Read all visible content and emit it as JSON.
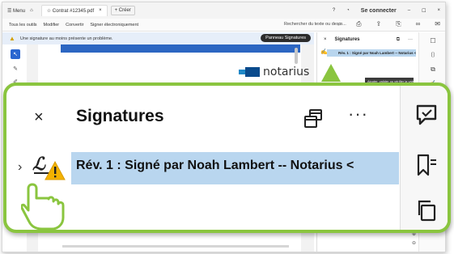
{
  "app": {
    "titlebar": {
      "menu_label": "☰ Menu",
      "home_icon": "home-icon",
      "tab_title": "☆ Contrat #12345.pdf",
      "tab_close": "×",
      "new_tab": "+ Créer",
      "signin": "Se connecter"
    },
    "menubar": {
      "items": [
        "Tous les outils",
        "Modifier",
        "Convertir",
        "Signer électroniquement"
      ],
      "search_text": "Rechercher du texte ou des o..."
    },
    "infobar": {
      "message": "Une signature au moins présente un problème.",
      "button": "Panneau Signatures"
    },
    "document": {
      "logo_text": "notarius"
    },
    "sigpanel": {
      "title": "Signatures",
      "row_text": "Rév. 1 : Signé par Noah Lambert -- Notarius <",
      "tooltip": "Ajouter, valider ou vérifier la valeur de..."
    }
  },
  "zoom": {
    "close": "×",
    "title": "Signatures",
    "more": "···",
    "chevron": "›",
    "signature_row": "Rév. 1 : Signé par Noah Lambert -- Notarius <",
    "icons": {
      "copy": "copy-windows-icon",
      "comment": "comment-icon",
      "bookmark": "bookmark-list-icon",
      "pages": "pages-copy-icon",
      "signature_warning": "signature-warning-icon",
      "hand": "pointing-hand-icon"
    }
  },
  "colors": {
    "accent_green": "#8ac53f",
    "selection_blue": "#b9d6ef",
    "adobe_blue": "#2c66c2",
    "warning_yellow": "#f3b200"
  }
}
